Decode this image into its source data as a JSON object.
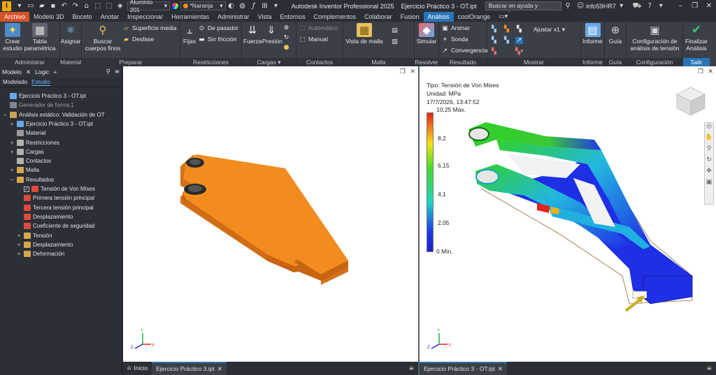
{
  "titlebar": {
    "material_combo": "Aluminio 201",
    "color_combo": "*Naranja",
    "app_title": "Autodesk Inventor Professional 2025",
    "doc_title": "Ejercicio Práctico 3 - OT.ipt",
    "search_placeholder": "Buscar en ayuda y comandos...",
    "user": "info59HR7"
  },
  "ribbon_tabs": [
    "Archivo",
    "Modelo 3D",
    "Boceto",
    "Anotar",
    "Inspeccionar",
    "Herramientas",
    "Administrar",
    "Vista",
    "Entornos",
    "Complementos",
    "Colaborar",
    "Fusion",
    "Análisis",
    "coolOrange"
  ],
  "ribbon": {
    "administrar": {
      "title": "Administrar",
      "crear_estudio": "Crear estudio",
      "tabla_parametrica": "Tabla paramétrica"
    },
    "material": {
      "title": "Material",
      "asignar": "Asignar"
    },
    "preparar": {
      "title": "Preparar",
      "buscar_cuerpos": "Buscar cuerpos finos",
      "superficie_media": "Superficie media",
      "desfase": "Desfase"
    },
    "restricciones": {
      "title": "Restricciones",
      "fijas": "Fijas",
      "de_pasador": "De pasador",
      "sin_friccion": "Sin fricción"
    },
    "cargas": {
      "title": "Cargas",
      "fuerza": "Fuerza",
      "presion": "Presión"
    },
    "contactos": {
      "title": "Contactos",
      "automatico": "Automático",
      "manual": "Manual"
    },
    "malla": {
      "title": "Malla",
      "vista_de_malla": "Vista de malla"
    },
    "resolver": {
      "title": "Resolver",
      "simular": "Simular"
    },
    "resultado": {
      "title": "Resultado",
      "animar": "Animar",
      "sonda": "Sonda",
      "convergencia": "Convergencia"
    },
    "mostrar": {
      "title": "Mostrar",
      "ajustar": "Ajustar x1"
    },
    "informe": {
      "title": "Informe",
      "informe": "Informe"
    },
    "guia": {
      "title": "Guía",
      "guia": "Guía"
    },
    "configuracion": {
      "title": "Configuración",
      "config_analisis": "Configuración de análisis de tensión"
    },
    "salir": {
      "title": "Salir",
      "finalizar": "Finalizar Análisis"
    }
  },
  "browser": {
    "tab_modelo": "Modelo",
    "tab_logic": "Logic",
    "sub_modelado": "Modelado",
    "sub_estudio": "Estudio",
    "tree": [
      {
        "label": "Ejercicio Práctico 3 - OT.ipt",
        "color": "#6aa9e8"
      },
      {
        "label": "Generador de forma:1",
        "color": "#7d8590"
      },
      {
        "label": "Análisis estático: Validación de OT",
        "color": "#c9a35a"
      },
      {
        "label": "Ejercicio Práctico 3 - OT.ipt",
        "color": "#6aa9e8"
      },
      {
        "label": "Material",
        "color": "#9a9a9a"
      },
      {
        "label": "Restricciones",
        "color": "#b0b0b0"
      },
      {
        "label": "Cargas",
        "color": "#b0b0b0"
      },
      {
        "label": "Contactos",
        "color": "#b0b0b0"
      },
      {
        "label": "Malla",
        "color": "#d8a64e"
      },
      {
        "label": "Resultados",
        "color": "#d8a64e"
      },
      {
        "label": "Tensión de Von Mises",
        "color": "#e04a3a"
      },
      {
        "label": "Primera tensión principal",
        "color": "#e04a3a"
      },
      {
        "label": "Tercera tensión principal",
        "color": "#e04a3a"
      },
      {
        "label": "Desplazamiento",
        "color": "#e04a3a"
      },
      {
        "label": "Coeficiente de seguridad",
        "color": "#e04a3a"
      },
      {
        "label": "Tensión",
        "color": "#d8a64e"
      },
      {
        "label": "Desplazamiento",
        "color": "#d8a64e"
      },
      {
        "label": "Deformación",
        "color": "#d8a64e"
      }
    ]
  },
  "legend": {
    "tipo": "Tipo: Tensión de Von Mises",
    "unidad": "Unidad: MPa",
    "fecha": "17/7/2026, 13:47:52",
    "max": "10,25 Máx.",
    "ticks": [
      "8,2",
      "6,15",
      "4,1",
      "2,05"
    ],
    "min": "0 Mín."
  },
  "doc_tabs_left": {
    "inicio": "Inicio",
    "doc": "Ejercicio Práctico 3.ipt"
  },
  "doc_tabs_right": {
    "doc": "Ejercicio Práctico 3 - OT.ipt"
  },
  "colors": {
    "accent": "#2874b8",
    "file_tab": "#d4542a",
    "part_orange": "#f28c1e"
  }
}
